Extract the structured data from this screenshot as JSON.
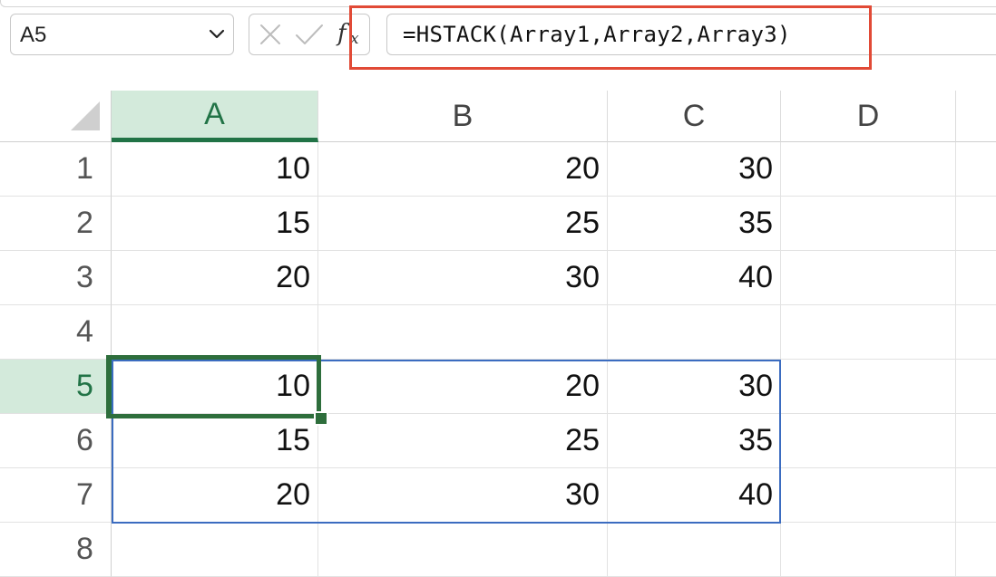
{
  "name_box": {
    "value": "A5"
  },
  "formula_bar": {
    "fx_label": "f",
    "fx_sub": "x",
    "formula": "=HSTACK(Array1,Array2,Array3)"
  },
  "columns": [
    {
      "id": "A",
      "label": "A",
      "selected": true
    },
    {
      "id": "B",
      "label": "B",
      "selected": false
    },
    {
      "id": "C",
      "label": "C",
      "selected": false
    },
    {
      "id": "D",
      "label": "D",
      "selected": false
    }
  ],
  "rows": [
    {
      "label": "1",
      "cells": [
        "10",
        "20",
        "30",
        ""
      ]
    },
    {
      "label": "2",
      "cells": [
        "15",
        "25",
        "35",
        ""
      ]
    },
    {
      "label": "3",
      "cells": [
        "20",
        "30",
        "40",
        ""
      ]
    },
    {
      "label": "4",
      "cells": [
        "",
        "",
        "",
        ""
      ]
    },
    {
      "label": "5",
      "cells": [
        "10",
        "20",
        "30",
        ""
      ]
    },
    {
      "label": "6",
      "cells": [
        "15",
        "25",
        "35",
        ""
      ]
    },
    {
      "label": "7",
      "cells": [
        "20",
        "30",
        "40",
        ""
      ]
    },
    {
      "label": "8",
      "cells": [
        "",
        "",
        "",
        ""
      ]
    }
  ],
  "selection": {
    "active_cell": "A5",
    "selected_row": "5",
    "spill_range": "A5:C7"
  },
  "colors": {
    "selection_green": "#217346",
    "header_highlight": "#d3eadb",
    "spill_border": "#3b6cc0",
    "annotation_red": "#e14a36"
  },
  "icons": {
    "name_box_dropdown": "chevron-down-icon",
    "cancel": "close-icon",
    "enter": "checkmark-icon",
    "insert_function": "fx-icon",
    "select_all": "select-all-triangle-icon"
  }
}
